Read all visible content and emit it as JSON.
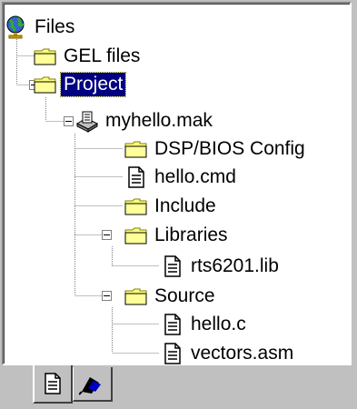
{
  "tree": {
    "root": {
      "label": "Files",
      "icon": "globe-icon"
    },
    "items": [
      {
        "label": "GEL files",
        "icon": "folder-icon"
      },
      {
        "label": "Project",
        "icon": "folder-icon",
        "selected": true,
        "expanded": true
      },
      {
        "label": "myhello.mak",
        "icon": "project-file-icon",
        "expanded": true
      },
      {
        "label": "DSP/BIOS Config",
        "icon": "folder-icon"
      },
      {
        "label": "hello.cmd",
        "icon": "document-icon"
      },
      {
        "label": "Include",
        "icon": "folder-icon"
      },
      {
        "label": "Libraries",
        "icon": "folder-icon",
        "expanded": true
      },
      {
        "label": "rts6201.lib",
        "icon": "document-icon"
      },
      {
        "label": "Source",
        "icon": "folder-icon",
        "expanded": true
      },
      {
        "label": "hello.c",
        "icon": "document-icon"
      },
      {
        "label": "vectors.asm",
        "icon": "document-icon"
      }
    ]
  },
  "tabs": [
    {
      "icon": "file-view-icon",
      "active": true
    },
    {
      "icon": "bookmark-view-icon",
      "active": false
    }
  ],
  "colors": {
    "selection": "#000080",
    "folder": "#ffff80",
    "window": "#c0c0c0"
  }
}
